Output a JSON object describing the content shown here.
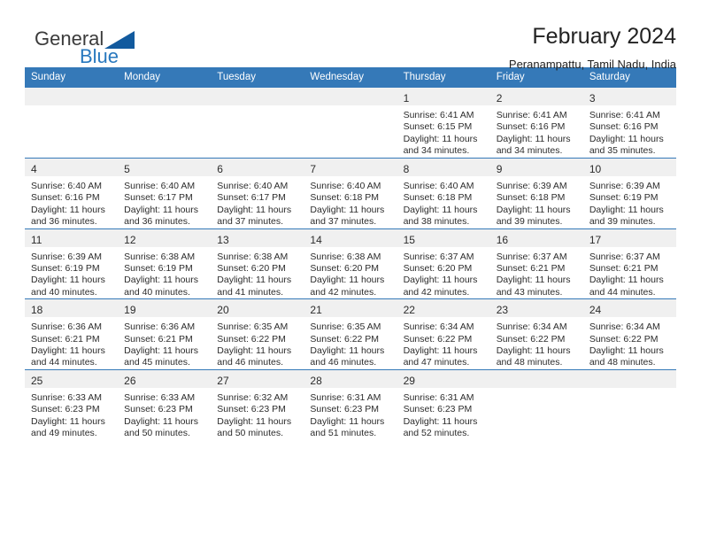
{
  "brand": {
    "name_part1": "General",
    "name_part2": "Blue",
    "triangle_color": "#125a9e",
    "blue_color": "#2878be"
  },
  "header": {
    "title": "February 2024",
    "subtitle": "Peranampattu, Tamil Nadu, India"
  },
  "theme": {
    "header_bg": "#3579b8",
    "daynum_bg": "#f0f0f0",
    "grid_line": "#3579b8"
  },
  "weekday_headers": [
    "Sunday",
    "Monday",
    "Tuesday",
    "Wednesday",
    "Thursday",
    "Friday",
    "Saturday"
  ],
  "weeks": [
    [
      {
        "day": "",
        "sunrise": "",
        "sunset": "",
        "daylight_line1": "",
        "daylight_line2": "",
        "empty": true
      },
      {
        "day": "",
        "sunrise": "",
        "sunset": "",
        "daylight_line1": "",
        "daylight_line2": "",
        "empty": true
      },
      {
        "day": "",
        "sunrise": "",
        "sunset": "",
        "daylight_line1": "",
        "daylight_line2": "",
        "empty": true
      },
      {
        "day": "",
        "sunrise": "",
        "sunset": "",
        "daylight_line1": "",
        "daylight_line2": "",
        "empty": true
      },
      {
        "day": "1",
        "sunrise": "Sunrise: 6:41 AM",
        "sunset": "Sunset: 6:15 PM",
        "daylight_line1": "Daylight: 11 hours",
        "daylight_line2": "and 34 minutes."
      },
      {
        "day": "2",
        "sunrise": "Sunrise: 6:41 AM",
        "sunset": "Sunset: 6:16 PM",
        "daylight_line1": "Daylight: 11 hours",
        "daylight_line2": "and 34 minutes."
      },
      {
        "day": "3",
        "sunrise": "Sunrise: 6:41 AM",
        "sunset": "Sunset: 6:16 PM",
        "daylight_line1": "Daylight: 11 hours",
        "daylight_line2": "and 35 minutes."
      }
    ],
    [
      {
        "day": "4",
        "sunrise": "Sunrise: 6:40 AM",
        "sunset": "Sunset: 6:16 PM",
        "daylight_line1": "Daylight: 11 hours",
        "daylight_line2": "and 36 minutes."
      },
      {
        "day": "5",
        "sunrise": "Sunrise: 6:40 AM",
        "sunset": "Sunset: 6:17 PM",
        "daylight_line1": "Daylight: 11 hours",
        "daylight_line2": "and 36 minutes."
      },
      {
        "day": "6",
        "sunrise": "Sunrise: 6:40 AM",
        "sunset": "Sunset: 6:17 PM",
        "daylight_line1": "Daylight: 11 hours",
        "daylight_line2": "and 37 minutes."
      },
      {
        "day": "7",
        "sunrise": "Sunrise: 6:40 AM",
        "sunset": "Sunset: 6:18 PM",
        "daylight_line1": "Daylight: 11 hours",
        "daylight_line2": "and 37 minutes."
      },
      {
        "day": "8",
        "sunrise": "Sunrise: 6:40 AM",
        "sunset": "Sunset: 6:18 PM",
        "daylight_line1": "Daylight: 11 hours",
        "daylight_line2": "and 38 minutes."
      },
      {
        "day": "9",
        "sunrise": "Sunrise: 6:39 AM",
        "sunset": "Sunset: 6:18 PM",
        "daylight_line1": "Daylight: 11 hours",
        "daylight_line2": "and 39 minutes."
      },
      {
        "day": "10",
        "sunrise": "Sunrise: 6:39 AM",
        "sunset": "Sunset: 6:19 PM",
        "daylight_line1": "Daylight: 11 hours",
        "daylight_line2": "and 39 minutes."
      }
    ],
    [
      {
        "day": "11",
        "sunrise": "Sunrise: 6:39 AM",
        "sunset": "Sunset: 6:19 PM",
        "daylight_line1": "Daylight: 11 hours",
        "daylight_line2": "and 40 minutes."
      },
      {
        "day": "12",
        "sunrise": "Sunrise: 6:38 AM",
        "sunset": "Sunset: 6:19 PM",
        "daylight_line1": "Daylight: 11 hours",
        "daylight_line2": "and 40 minutes."
      },
      {
        "day": "13",
        "sunrise": "Sunrise: 6:38 AM",
        "sunset": "Sunset: 6:20 PM",
        "daylight_line1": "Daylight: 11 hours",
        "daylight_line2": "and 41 minutes."
      },
      {
        "day": "14",
        "sunrise": "Sunrise: 6:38 AM",
        "sunset": "Sunset: 6:20 PM",
        "daylight_line1": "Daylight: 11 hours",
        "daylight_line2": "and 42 minutes."
      },
      {
        "day": "15",
        "sunrise": "Sunrise: 6:37 AM",
        "sunset": "Sunset: 6:20 PM",
        "daylight_line1": "Daylight: 11 hours",
        "daylight_line2": "and 42 minutes."
      },
      {
        "day": "16",
        "sunrise": "Sunrise: 6:37 AM",
        "sunset": "Sunset: 6:21 PM",
        "daylight_line1": "Daylight: 11 hours",
        "daylight_line2": "and 43 minutes."
      },
      {
        "day": "17",
        "sunrise": "Sunrise: 6:37 AM",
        "sunset": "Sunset: 6:21 PM",
        "daylight_line1": "Daylight: 11 hours",
        "daylight_line2": "and 44 minutes."
      }
    ],
    [
      {
        "day": "18",
        "sunrise": "Sunrise: 6:36 AM",
        "sunset": "Sunset: 6:21 PM",
        "daylight_line1": "Daylight: 11 hours",
        "daylight_line2": "and 44 minutes."
      },
      {
        "day": "19",
        "sunrise": "Sunrise: 6:36 AM",
        "sunset": "Sunset: 6:21 PM",
        "daylight_line1": "Daylight: 11 hours",
        "daylight_line2": "and 45 minutes."
      },
      {
        "day": "20",
        "sunrise": "Sunrise: 6:35 AM",
        "sunset": "Sunset: 6:22 PM",
        "daylight_line1": "Daylight: 11 hours",
        "daylight_line2": "and 46 minutes."
      },
      {
        "day": "21",
        "sunrise": "Sunrise: 6:35 AM",
        "sunset": "Sunset: 6:22 PM",
        "daylight_line1": "Daylight: 11 hours",
        "daylight_line2": "and 46 minutes."
      },
      {
        "day": "22",
        "sunrise": "Sunrise: 6:34 AM",
        "sunset": "Sunset: 6:22 PM",
        "daylight_line1": "Daylight: 11 hours",
        "daylight_line2": "and 47 minutes."
      },
      {
        "day": "23",
        "sunrise": "Sunrise: 6:34 AM",
        "sunset": "Sunset: 6:22 PM",
        "daylight_line1": "Daylight: 11 hours",
        "daylight_line2": "and 48 minutes."
      },
      {
        "day": "24",
        "sunrise": "Sunrise: 6:34 AM",
        "sunset": "Sunset: 6:22 PM",
        "daylight_line1": "Daylight: 11 hours",
        "daylight_line2": "and 48 minutes."
      }
    ],
    [
      {
        "day": "25",
        "sunrise": "Sunrise: 6:33 AM",
        "sunset": "Sunset: 6:23 PM",
        "daylight_line1": "Daylight: 11 hours",
        "daylight_line2": "and 49 minutes."
      },
      {
        "day": "26",
        "sunrise": "Sunrise: 6:33 AM",
        "sunset": "Sunset: 6:23 PM",
        "daylight_line1": "Daylight: 11 hours",
        "daylight_line2": "and 50 minutes."
      },
      {
        "day": "27",
        "sunrise": "Sunrise: 6:32 AM",
        "sunset": "Sunset: 6:23 PM",
        "daylight_line1": "Daylight: 11 hours",
        "daylight_line2": "and 50 minutes."
      },
      {
        "day": "28",
        "sunrise": "Sunrise: 6:31 AM",
        "sunset": "Sunset: 6:23 PM",
        "daylight_line1": "Daylight: 11 hours",
        "daylight_line2": "and 51 minutes."
      },
      {
        "day": "29",
        "sunrise": "Sunrise: 6:31 AM",
        "sunset": "Sunset: 6:23 PM",
        "daylight_line1": "Daylight: 11 hours",
        "daylight_line2": "and 52 minutes."
      },
      {
        "day": "",
        "sunrise": "",
        "sunset": "",
        "daylight_line1": "",
        "daylight_line2": "",
        "empty": true
      },
      {
        "day": "",
        "sunrise": "",
        "sunset": "",
        "daylight_line1": "",
        "daylight_line2": "",
        "empty": true
      }
    ]
  ]
}
